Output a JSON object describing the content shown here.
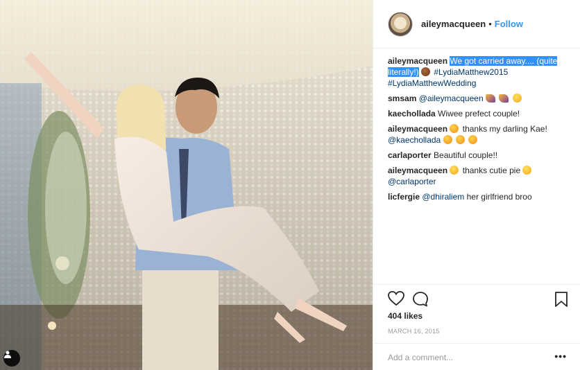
{
  "header": {
    "username": "aileymacqueen",
    "separator": "•",
    "follow_label": "Follow"
  },
  "caption": {
    "username": "aileymacqueen",
    "highlighted_text": "We got carried away.... (quite literally!)",
    "hashtag1": "#LydiaMatthew2015",
    "hashtag2": "#LydiaMatthewWedding"
  },
  "comments": [
    {
      "username": "smsam",
      "mention": "@aileymacqueen",
      "text": ""
    },
    {
      "username": "kaechollada",
      "mention": "",
      "text": "Wiwee prefect couple!"
    },
    {
      "username": "aileymacqueen",
      "text": "thanks my darling Kae!",
      "mention": "@kaechollada"
    },
    {
      "username": "carlaporter",
      "mention": "",
      "text": "Beautiful couple!!"
    },
    {
      "username": "aileymacqueen",
      "text": "thanks cutie pie",
      "mention": "@carlaporter"
    },
    {
      "username": "licfergie",
      "mention": "@dhiraliem",
      "text": "her girlfriend broo"
    }
  ],
  "actions": {
    "likes": "404 likes",
    "date": "MARCH 16, 2015",
    "comment_placeholder": "Add a comment...",
    "more_label": "•••"
  },
  "icons": [
    "heart-icon",
    "comment-icon",
    "bookmark-icon",
    "user-tag-icon"
  ],
  "colors": {
    "link": "#3897f0",
    "selection": "#3390ff"
  }
}
